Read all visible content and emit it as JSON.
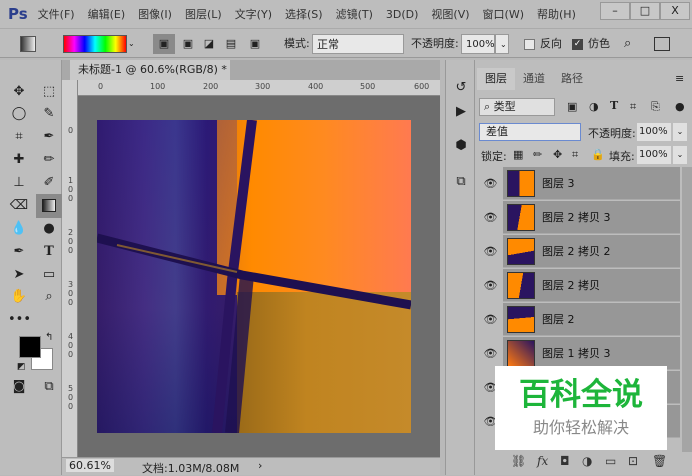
{
  "app": {
    "logo": "Ps"
  },
  "menu": [
    "文件(F)",
    "编辑(E)",
    "图像(I)",
    "图层(L)",
    "文字(Y)",
    "选择(S)",
    "滤镜(T)",
    "3D(D)",
    "视图(V)",
    "窗口(W)",
    "帮助(H)"
  ],
  "window_controls": {
    "minimize": "–",
    "maximize": "□",
    "close": "X"
  },
  "options": {
    "mode_label": "模式:",
    "mode_value": "正常",
    "opacity_label": "不透明度:",
    "opacity_value": "100%",
    "reverse_label": "反向",
    "reverse_checked": false,
    "dither_label": "仿色",
    "dither_checked": true
  },
  "document": {
    "tab_title": "未标题-1 @ 60.6%(RGB/8) *",
    "close": "×",
    "ruler_top": [
      "0",
      "100",
      "200",
      "300",
      "400",
      "500",
      "600"
    ],
    "ruler_left": [
      "0",
      "100",
      "200",
      "300",
      "400",
      "500"
    ]
  },
  "status": {
    "zoom": "60.61%",
    "doc_info": "文档:1.03M/8.08M",
    "arrow": "›"
  },
  "layers_panel": {
    "tabs": [
      "图层",
      "通道",
      "路径"
    ],
    "filter_label": "类型",
    "blend_mode": "差值",
    "opacity_label": "不透明度:",
    "opacity_value": "100%",
    "lock_label": "锁定:",
    "fill_label": "填充:",
    "fill_value": "100%",
    "layers": [
      {
        "name": "图层 3"
      },
      {
        "name": "图层 2 拷贝 3"
      },
      {
        "name": "图层 2 拷贝 2"
      },
      {
        "name": "图层 2 拷贝"
      },
      {
        "name": "图层 2"
      },
      {
        "name": "图层 1 拷贝 3"
      },
      {
        "name": ""
      },
      {
        "name": ""
      }
    ]
  },
  "colors": {
    "foreground": "#000000",
    "background": "#ffffff",
    "orange": "#ff8a00",
    "purple": "#2a1460"
  },
  "watermark": {
    "title": "百科全说",
    "subtitle": "助你轻松解决"
  }
}
